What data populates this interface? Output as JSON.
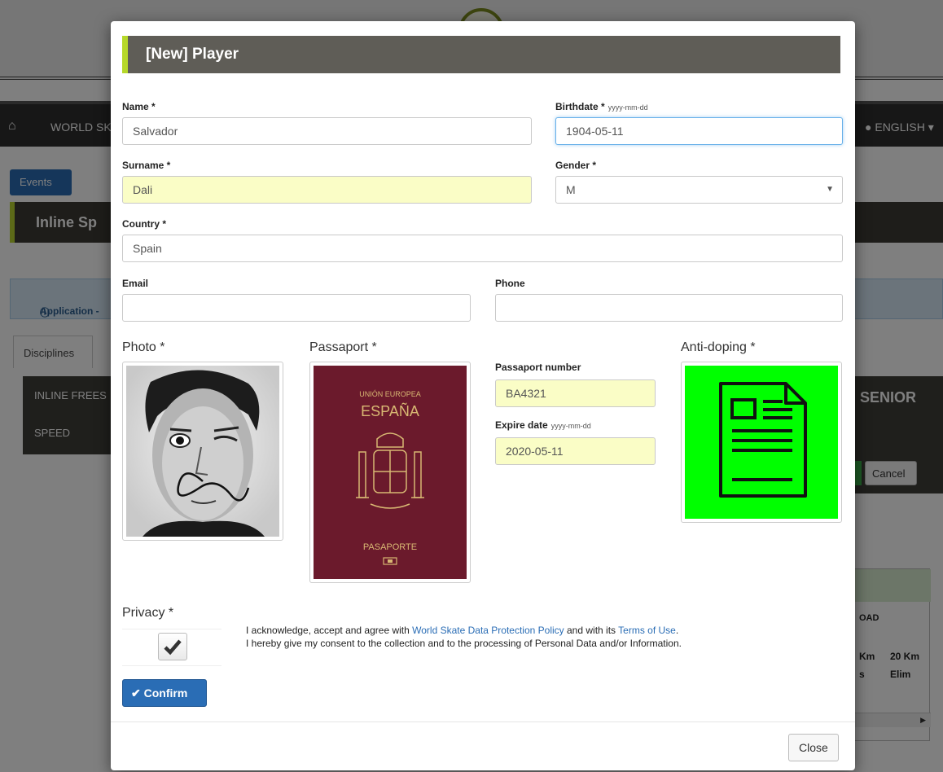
{
  "background": {
    "nav_text": "WORLD SK",
    "language": "ENGLISH",
    "events_button": "Events",
    "event_title": "Inline Sp",
    "info_text": "Application -",
    "tab_disciplines": "Disciplines",
    "discipline_1": "INLINE FREES",
    "discipline_2": "SPEED",
    "category": "SENIOR",
    "cancel_button": "Cancel",
    "road_label": "OAD",
    "col_1": [
      "Km",
      "s"
    ],
    "col_2": [
      "20 Km",
      "Elim"
    ]
  },
  "modal": {
    "title": "[New] Player",
    "name": {
      "label": "Name *",
      "value": "Salvador"
    },
    "birthdate": {
      "label": "Birthdate *",
      "hint": "yyyy-mm-dd",
      "value": "1904-05-11"
    },
    "surname": {
      "label": "Surname *",
      "value": "Dali"
    },
    "gender": {
      "label": "Gender *",
      "value": "M"
    },
    "country": {
      "label": "Country *",
      "value": "Spain"
    },
    "email": {
      "label": "Email",
      "value": ""
    },
    "phone": {
      "label": "Phone",
      "value": ""
    },
    "photo_label": "Photo *",
    "passport_label": "Passaport *",
    "antidoping_label": "Anti-doping *",
    "passport_image": {
      "top": "UNIÓN EUROPEA",
      "country": "ESPAÑA",
      "bottom": "PASAPORTE"
    },
    "passport_number": {
      "label": "Passaport number",
      "value": "BA4321"
    },
    "expire_date": {
      "label": "Expire date",
      "hint": "yyyy-mm-dd",
      "value": "2020-05-11"
    },
    "privacy": {
      "label": "Privacy *",
      "checked": true,
      "line1_prefix": "I acknowledge, accept and agree with ",
      "link_policy": "World Skate Data Protection Policy",
      "line1_middle": " and with its ",
      "link_terms": "Terms of Use",
      "line1_suffix": ".",
      "line2": "I hereby give my consent to the collection and to the processing of Personal Data and/or Information."
    },
    "confirm_button": "Confirm",
    "close_button": "Close"
  },
  "colors": {
    "header_bg": "#5f5d57",
    "accent": "#b6d82a",
    "primary": "#2a6db5",
    "highlight_field": "#fafdc6",
    "antidoping_bg": "#00ff00"
  },
  "icons": [
    "home-icon",
    "globe-icon",
    "info-icon",
    "check-icon",
    "checkmark-icon",
    "document-icon",
    "caret-down-icon"
  ]
}
